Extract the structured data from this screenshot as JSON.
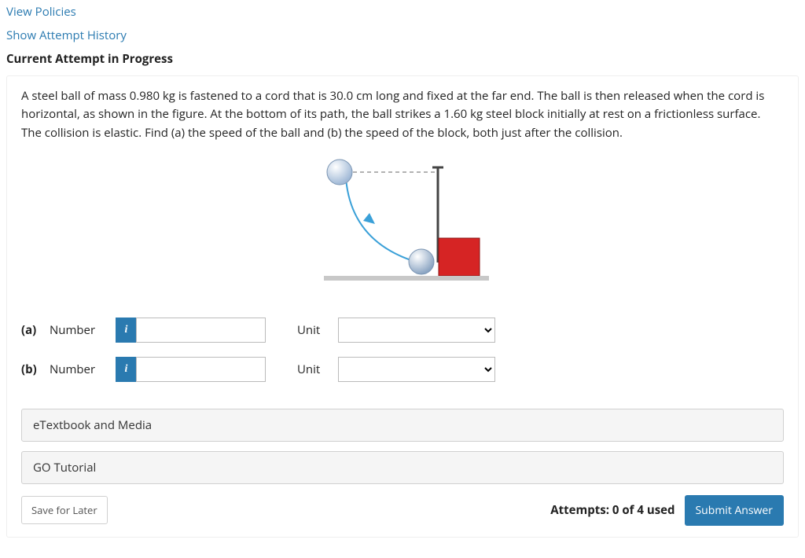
{
  "links": {
    "view_policies": "View Policies",
    "show_history": "Show Attempt History"
  },
  "header": "Current Attempt in Progress",
  "question_text": "A steel ball of mass 0.980 kg is fastened to a cord that is 30.0 cm long and fixed at the far end. The ball is then released when the cord is horizontal, as shown in the figure. At the bottom of its path, the ball strikes a 1.60 kg steel block initially at rest on a frictionless surface. The collision is elastic. Find (a) the speed of the ball and (b) the speed of the block, both just after the collision.",
  "parts": {
    "a": {
      "label": "(a)",
      "number_label": "Number",
      "unit_label": "Unit",
      "value": "",
      "unit_value": ""
    },
    "b": {
      "label": "(b)",
      "number_label": "Number",
      "unit_label": "Unit",
      "value": "",
      "unit_value": ""
    }
  },
  "info_icon": "i",
  "resources": {
    "etextbook": "eTextbook and Media",
    "go_tutorial": "GO Tutorial"
  },
  "footer": {
    "save": "Save for Later",
    "attempts": "Attempts: 0 of 4 used",
    "submit": "Submit Answer"
  }
}
